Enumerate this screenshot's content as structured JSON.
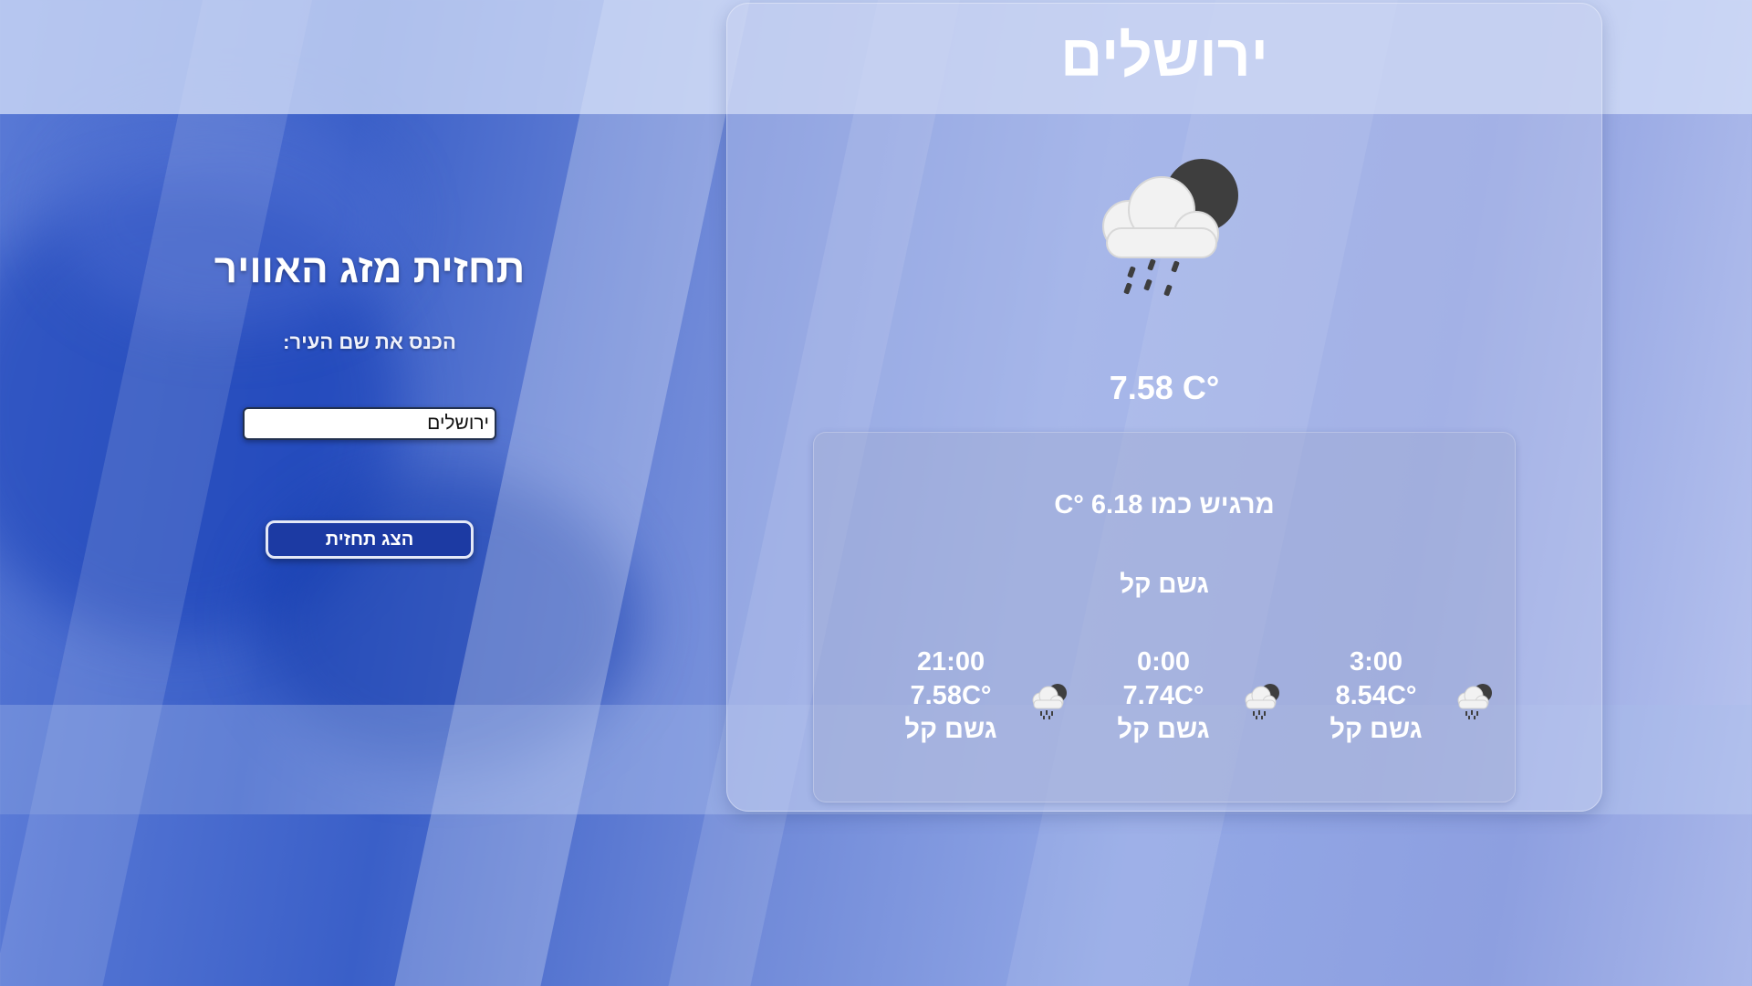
{
  "form": {
    "title": "תחזית מזג האוויר",
    "label": "הכנס את שם העיר:",
    "input_value": "ירושלים",
    "button_label": "הצג תחזית"
  },
  "weather": {
    "city": "ירושלים",
    "main_icon": "rain-cloud-moon-icon",
    "temperature": "7.58 C°",
    "feels_like": "מרגיש כמו C° 6.18",
    "description": "גשם קל"
  },
  "forecast": [
    {
      "time": "3:00",
      "temp": "8.54C°",
      "desc": "גשם קל",
      "icon": "rain-cloud-moon-icon"
    },
    {
      "time": "0:00",
      "temp": "7.74C°",
      "desc": "גשם קל",
      "icon": "rain-cloud-moon-icon"
    },
    {
      "time": "21:00",
      "temp": "7.58C°",
      "desc": "גשם קל",
      "icon": "rain-cloud-moon-icon"
    }
  ]
}
